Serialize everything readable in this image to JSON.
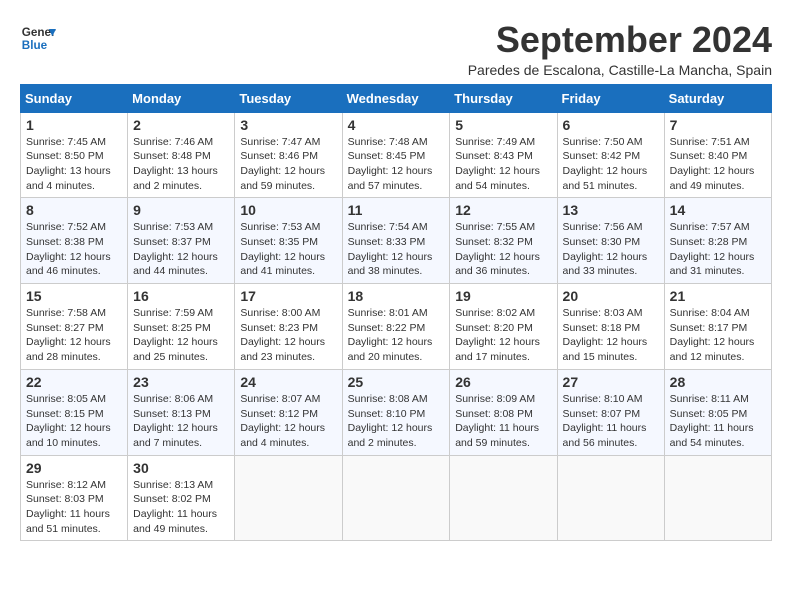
{
  "header": {
    "logo_line1": "General",
    "logo_line2": "Blue",
    "month_title": "September 2024",
    "location": "Paredes de Escalona, Castille-La Mancha, Spain"
  },
  "weekdays": [
    "Sunday",
    "Monday",
    "Tuesday",
    "Wednesday",
    "Thursday",
    "Friday",
    "Saturday"
  ],
  "weeks": [
    [
      {
        "day": "1",
        "info": "Sunrise: 7:45 AM\nSunset: 8:50 PM\nDaylight: 13 hours\nand 4 minutes."
      },
      {
        "day": "2",
        "info": "Sunrise: 7:46 AM\nSunset: 8:48 PM\nDaylight: 13 hours\nand 2 minutes."
      },
      {
        "day": "3",
        "info": "Sunrise: 7:47 AM\nSunset: 8:46 PM\nDaylight: 12 hours\nand 59 minutes."
      },
      {
        "day": "4",
        "info": "Sunrise: 7:48 AM\nSunset: 8:45 PM\nDaylight: 12 hours\nand 57 minutes."
      },
      {
        "day": "5",
        "info": "Sunrise: 7:49 AM\nSunset: 8:43 PM\nDaylight: 12 hours\nand 54 minutes."
      },
      {
        "day": "6",
        "info": "Sunrise: 7:50 AM\nSunset: 8:42 PM\nDaylight: 12 hours\nand 51 minutes."
      },
      {
        "day": "7",
        "info": "Sunrise: 7:51 AM\nSunset: 8:40 PM\nDaylight: 12 hours\nand 49 minutes."
      }
    ],
    [
      {
        "day": "8",
        "info": "Sunrise: 7:52 AM\nSunset: 8:38 PM\nDaylight: 12 hours\nand 46 minutes."
      },
      {
        "day": "9",
        "info": "Sunrise: 7:53 AM\nSunset: 8:37 PM\nDaylight: 12 hours\nand 44 minutes."
      },
      {
        "day": "10",
        "info": "Sunrise: 7:53 AM\nSunset: 8:35 PM\nDaylight: 12 hours\nand 41 minutes."
      },
      {
        "day": "11",
        "info": "Sunrise: 7:54 AM\nSunset: 8:33 PM\nDaylight: 12 hours\nand 38 minutes."
      },
      {
        "day": "12",
        "info": "Sunrise: 7:55 AM\nSunset: 8:32 PM\nDaylight: 12 hours\nand 36 minutes."
      },
      {
        "day": "13",
        "info": "Sunrise: 7:56 AM\nSunset: 8:30 PM\nDaylight: 12 hours\nand 33 minutes."
      },
      {
        "day": "14",
        "info": "Sunrise: 7:57 AM\nSunset: 8:28 PM\nDaylight: 12 hours\nand 31 minutes."
      }
    ],
    [
      {
        "day": "15",
        "info": "Sunrise: 7:58 AM\nSunset: 8:27 PM\nDaylight: 12 hours\nand 28 minutes."
      },
      {
        "day": "16",
        "info": "Sunrise: 7:59 AM\nSunset: 8:25 PM\nDaylight: 12 hours\nand 25 minutes."
      },
      {
        "day": "17",
        "info": "Sunrise: 8:00 AM\nSunset: 8:23 PM\nDaylight: 12 hours\nand 23 minutes."
      },
      {
        "day": "18",
        "info": "Sunrise: 8:01 AM\nSunset: 8:22 PM\nDaylight: 12 hours\nand 20 minutes."
      },
      {
        "day": "19",
        "info": "Sunrise: 8:02 AM\nSunset: 8:20 PM\nDaylight: 12 hours\nand 17 minutes."
      },
      {
        "day": "20",
        "info": "Sunrise: 8:03 AM\nSunset: 8:18 PM\nDaylight: 12 hours\nand 15 minutes."
      },
      {
        "day": "21",
        "info": "Sunrise: 8:04 AM\nSunset: 8:17 PM\nDaylight: 12 hours\nand 12 minutes."
      }
    ],
    [
      {
        "day": "22",
        "info": "Sunrise: 8:05 AM\nSunset: 8:15 PM\nDaylight: 12 hours\nand 10 minutes."
      },
      {
        "day": "23",
        "info": "Sunrise: 8:06 AM\nSunset: 8:13 PM\nDaylight: 12 hours\nand 7 minutes."
      },
      {
        "day": "24",
        "info": "Sunrise: 8:07 AM\nSunset: 8:12 PM\nDaylight: 12 hours\nand 4 minutes."
      },
      {
        "day": "25",
        "info": "Sunrise: 8:08 AM\nSunset: 8:10 PM\nDaylight: 12 hours\nand 2 minutes."
      },
      {
        "day": "26",
        "info": "Sunrise: 8:09 AM\nSunset: 8:08 PM\nDaylight: 11 hours\nand 59 minutes."
      },
      {
        "day": "27",
        "info": "Sunrise: 8:10 AM\nSunset: 8:07 PM\nDaylight: 11 hours\nand 56 minutes."
      },
      {
        "day": "28",
        "info": "Sunrise: 8:11 AM\nSunset: 8:05 PM\nDaylight: 11 hours\nand 54 minutes."
      }
    ],
    [
      {
        "day": "29",
        "info": "Sunrise: 8:12 AM\nSunset: 8:03 PM\nDaylight: 11 hours\nand 51 minutes."
      },
      {
        "day": "30",
        "info": "Sunrise: 8:13 AM\nSunset: 8:02 PM\nDaylight: 11 hours\nand 49 minutes."
      },
      {
        "day": "",
        "info": ""
      },
      {
        "day": "",
        "info": ""
      },
      {
        "day": "",
        "info": ""
      },
      {
        "day": "",
        "info": ""
      },
      {
        "day": "",
        "info": ""
      }
    ]
  ]
}
